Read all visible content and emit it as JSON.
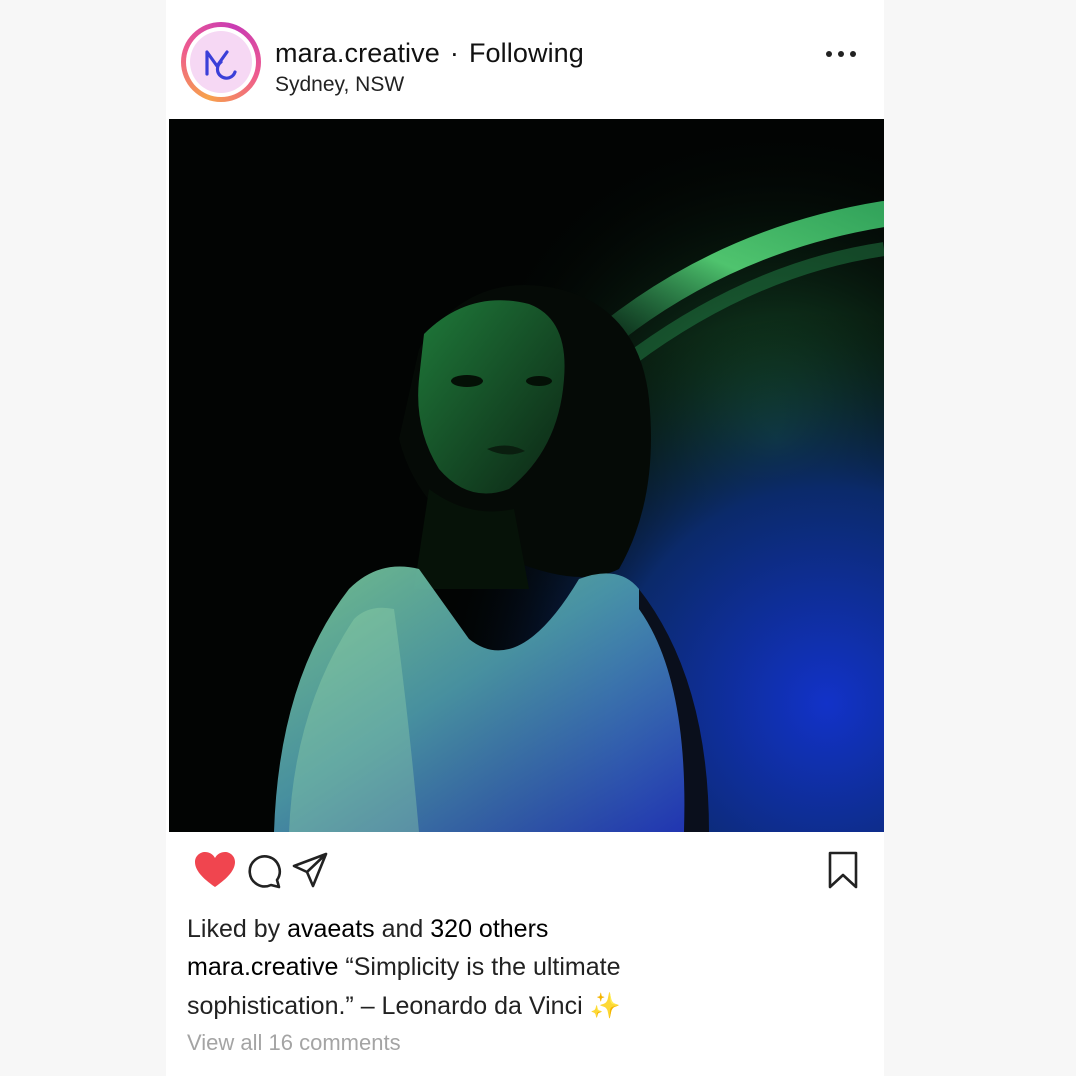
{
  "post": {
    "username": "mara.creative",
    "separator": "·",
    "follow_status": "Following",
    "location": "Sydney, NSW",
    "avatar_initials": "MC",
    "liked": true
  },
  "photo": {
    "colors": {
      "background": "#020403",
      "green_light": "#3ec86a",
      "blue_light": "#1530b0"
    }
  },
  "actions": {
    "like_icon": "heart-icon",
    "comment_icon": "comment-icon",
    "share_icon": "send-icon",
    "save_icon": "bookmark-icon",
    "like_color": "#f0454f"
  },
  "engagement": {
    "likes_prefix": "Liked by",
    "liked_by_user": "avaeats",
    "likes_and": "and",
    "likes_count_text": "320 others"
  },
  "caption": {
    "username": "mara.creative",
    "text": "“Simplicity is the ultimate sophistication.” – Leonardo da Vinci",
    "emoji": "✨"
  },
  "comments": {
    "view_all_text": "View all 16 comments"
  }
}
